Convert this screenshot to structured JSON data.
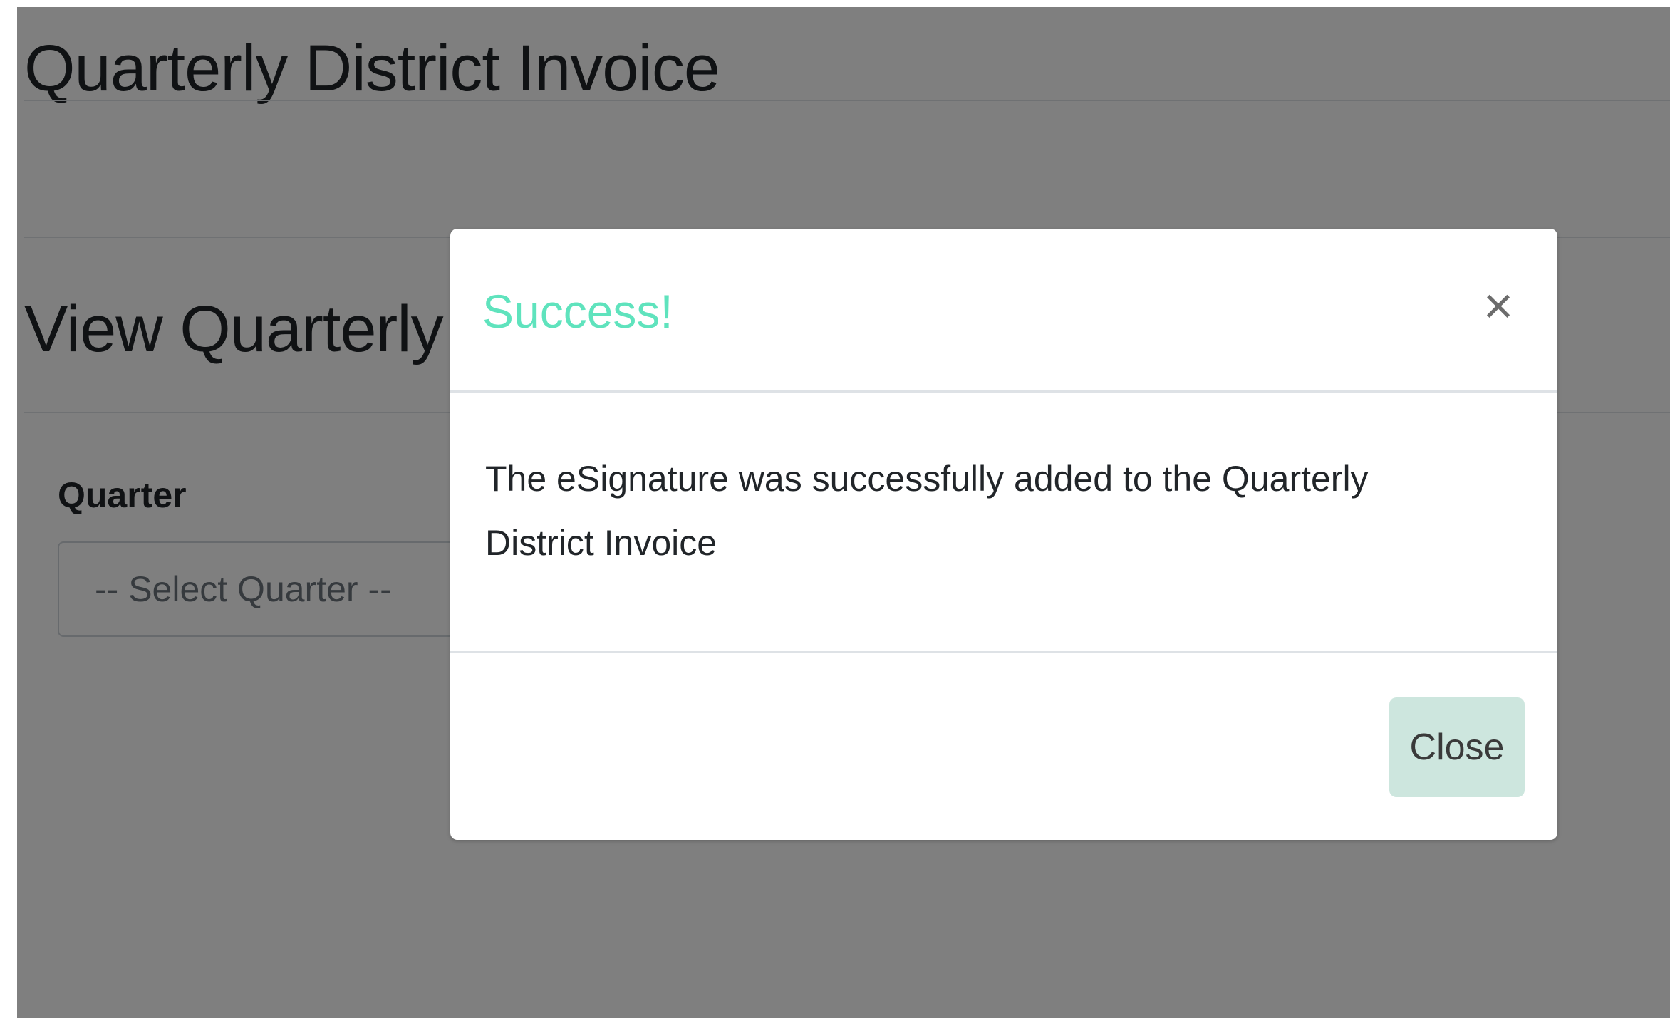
{
  "page": {
    "title": "Quarterly District Invoice",
    "section_title": "View Quarterly D",
    "quarter_label": "Quarter",
    "quarter_select_value": "-- Select Quarter --"
  },
  "modal": {
    "title": "Success!",
    "close_icon": "×",
    "message": "The eSignature was successfully added to the Quarterly District Invoice",
    "close_button_label": "Close"
  },
  "colors": {
    "success_title": "#5fe3bd",
    "close_button_bg": "#cde6de",
    "backdrop": "rgba(0,0,0,0.5)"
  }
}
